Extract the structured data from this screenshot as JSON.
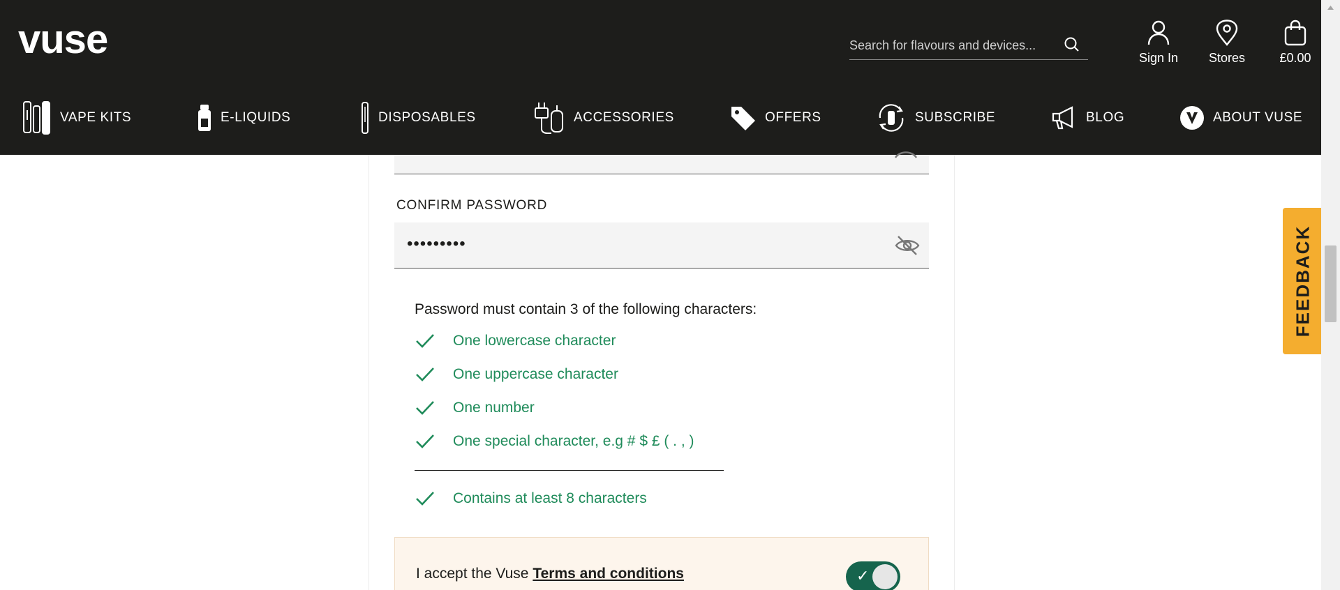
{
  "brand": {
    "logo_text": "vuse"
  },
  "search": {
    "placeholder": "Search for flavours and devices..."
  },
  "utility": {
    "sign_in": "Sign In",
    "stores": "Stores",
    "basket": "£0.00"
  },
  "nav": [
    {
      "label": "VAPE KITS",
      "icon": "vape-kits-icon"
    },
    {
      "label": "E-LIQUIDS",
      "icon": "e-liquid-icon"
    },
    {
      "label": "DISPOSABLES",
      "icon": "disposable-icon"
    },
    {
      "label": "ACCESSORIES",
      "icon": "accessories-icon"
    },
    {
      "label": "OFFERS",
      "icon": "tag-icon"
    },
    {
      "label": "SUBSCRIBE",
      "icon": "subscribe-icon"
    },
    {
      "label": "BLOG",
      "icon": "megaphone-icon"
    },
    {
      "label": "ABOUT VUSE",
      "icon": "vuse-v-icon"
    }
  ],
  "form": {
    "confirm_label": "CONFIRM PASSWORD",
    "confirm_value": "•••••••••",
    "rules_title": "Password must contain 3 of the following characters:",
    "rules": [
      "One lowercase character",
      "One uppercase character",
      "One number",
      "One special character, e.g # $ £ ( . , )"
    ],
    "length_rule": "Contains at least 8 characters",
    "terms_prefix": "I accept the Vuse ",
    "terms_link": "Terms and conditions",
    "terms_accepted": true
  },
  "feedback": {
    "label": "FEEDBACK"
  },
  "colors": {
    "header_bg": "#1d1d1b",
    "success_green": "#1f8b5a",
    "toggle_green": "#16644d",
    "feedback_orange": "#f4ad2f",
    "terms_bg": "#fdf5ec"
  }
}
